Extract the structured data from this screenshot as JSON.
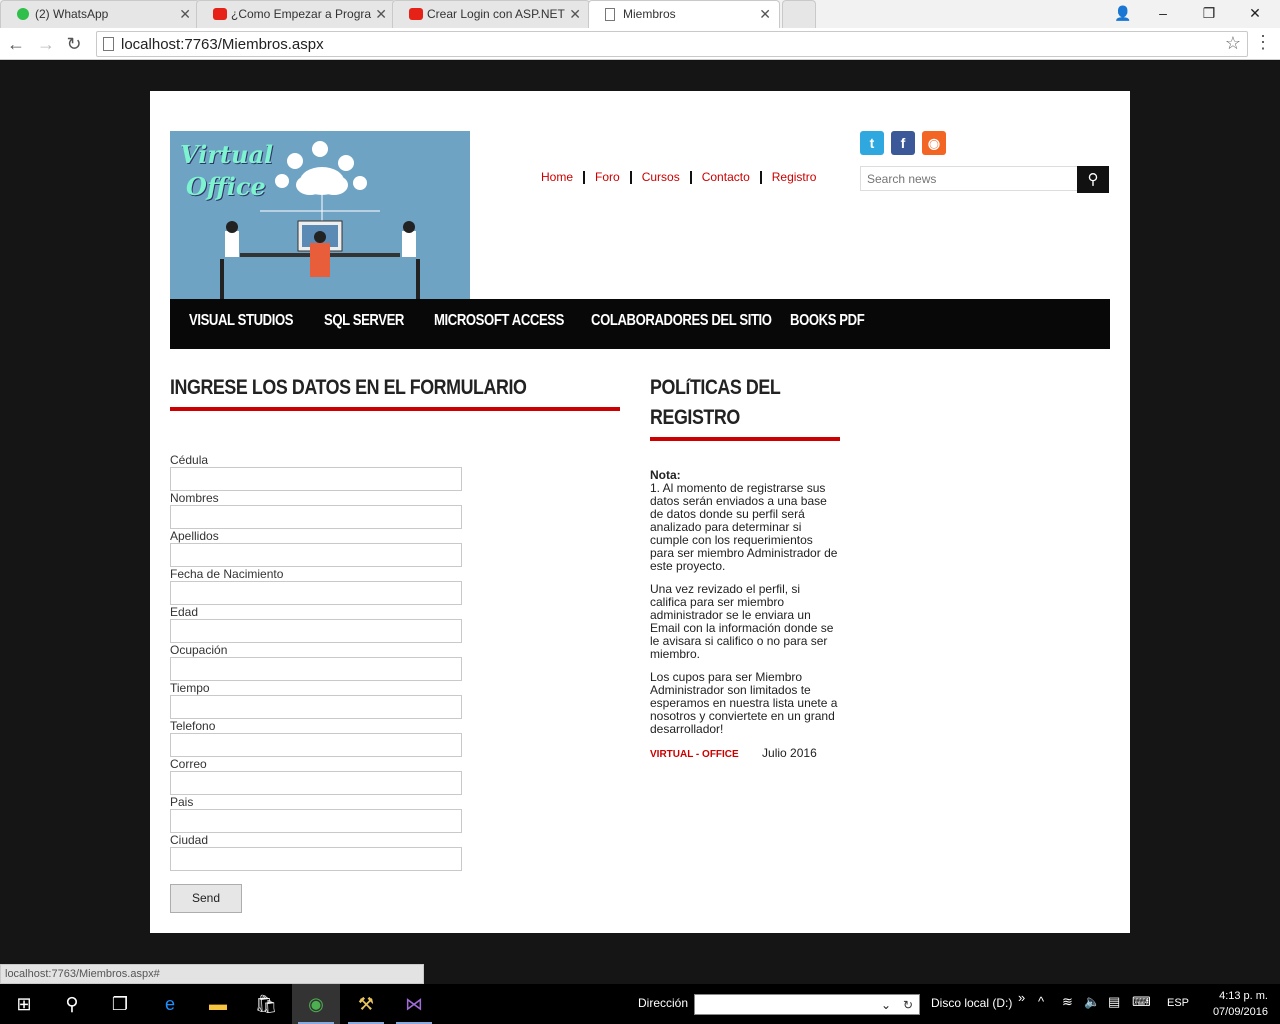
{
  "browser": {
    "tabs": [
      {
        "label": "(2) WhatsApp",
        "icon": "whatsapp-icon",
        "color": "#2fbf4a"
      },
      {
        "label": "¿Como Empezar a Progra",
        "icon": "youtube-icon",
        "color": "#e62117"
      },
      {
        "label": "Crear Login con ASP.NET",
        "icon": "youtube-icon",
        "color": "#e62117"
      },
      {
        "label": "Miembros",
        "icon": "page-icon",
        "color": "#ffffff"
      }
    ],
    "url": "localhost:7763/Miembros.aspx",
    "status_url": "localhost:7763/Miembros.aspx#"
  },
  "site": {
    "logo": {
      "line1": "Virtual",
      "line2": "Office"
    },
    "top_nav": [
      "Home",
      "Foro",
      "Cursos",
      "Contacto",
      "Registro"
    ],
    "social": [
      {
        "name": "twitter-icon",
        "glyph": "t",
        "color": "#2fa8e0"
      },
      {
        "name": "facebook-icon",
        "glyph": "f",
        "color": "#3b5998"
      },
      {
        "name": "rss-icon",
        "glyph": "◉",
        "color": "#f26522"
      }
    ],
    "search": {
      "placeholder": "Search news",
      "button_glyph": "⚲"
    },
    "main_nav": [
      "VISUAL STUDIOS",
      "SQL SERVER",
      "MICROSOFT ACCESS",
      "COLABORADORES DEL SITIO",
      "BOOKS PDF"
    ],
    "form": {
      "heading": "INGRESE LOS DATOS EN EL FORMULARIO",
      "fields": [
        "Cédula",
        "Nombres",
        "Apellidos",
        "Fecha de Nacimiento",
        "Edad",
        "Ocupación",
        "Tiempo",
        "Telefono",
        "Correo",
        "Pais",
        "Ciudad"
      ],
      "send_label": "Send"
    },
    "policy": {
      "heading": "POLíTICAS DEL REGISTRO",
      "note_label": "Nota:",
      "paragraphs": [
        "1. Al momento de registrarse sus datos serán enviados a una base de datos donde su perfil será analizado para determinar si cumple con los requerimientos para ser miembro Administrador de este proyecto.",
        "Una vez revizado el perfil, si califica para ser miembro administrador se le enviara un Email con la información donde se le avisara si califico o no para ser miembro.",
        "Los cupos para ser Miembro Administrador son limitados te esperamos en nuestra lista unete a nosotros y conviertete en un grand desarrollador!"
      ],
      "brand": "VIRTUAL - OFFICE",
      "date": "Julio 2016"
    }
  },
  "taskbar": {
    "address_label": "Dirección",
    "disk_label": "Disco local (D:)",
    "language": "ESP",
    "time": "4:13 p. m.",
    "date": "07/09/2016"
  }
}
